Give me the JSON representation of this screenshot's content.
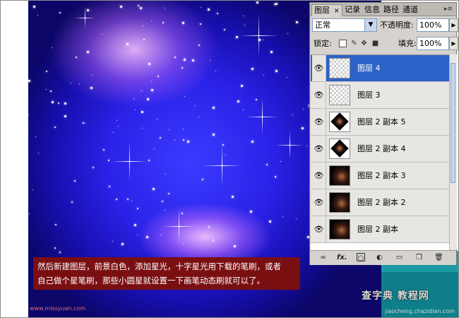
{
  "canvas": {
    "caption_lines": [
      "然后新建图层，前景白色，添加星光，十字星光用下载的笔刷，或者",
      "自己做个星笔刷，那些小圆星就设置一下画笔动态刷就可以了。"
    ],
    "credit": "www.missyuan.com",
    "watermark": "查字典 教程网",
    "watermark_url": "jiaocheng.chazidian.com"
  },
  "panel": {
    "tabs": [
      "图层",
      "记录",
      "信息",
      "路径",
      "通道"
    ],
    "close_glyph": "×",
    "menu_glyph": "▸≡",
    "blend_mode": "正常",
    "opacity_label": "不透明度:",
    "opacity_value": "100%",
    "lock_label": "锁定:",
    "fill_label": "填充:",
    "fill_value": "100%",
    "layers": [
      {
        "name": "图层 4",
        "selected": true,
        "thumb": "transparent"
      },
      {
        "name": "图层 3",
        "selected": false,
        "thumb": "transparent"
      },
      {
        "name": "图层 2 副本 5",
        "selected": false,
        "thumb": "diamond"
      },
      {
        "name": "图层 2 副本 4",
        "selected": false,
        "thumb": "diamond"
      },
      {
        "name": "图层 2 副本 3",
        "selected": false,
        "thumb": "dark"
      },
      {
        "name": "图层 2 副本 2",
        "selected": false,
        "thumb": "dark"
      },
      {
        "name": "图层 2 副本",
        "selected": false,
        "thumb": "dark"
      }
    ],
    "bottom_icons": [
      "link-icon",
      "fx-icon",
      "mask-icon",
      "adjustment-icon",
      "folder-icon",
      "new-layer-icon",
      "trash-icon"
    ],
    "fx_label": "fx."
  },
  "colors": {
    "selection": "#2d63c8",
    "caption_bg": "#7a0f12",
    "teal": "#0e7f8a"
  }
}
